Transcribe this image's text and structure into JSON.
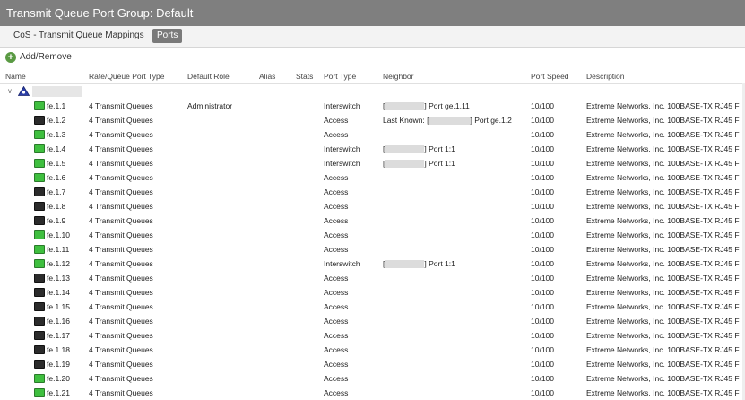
{
  "title": "Transmit Queue Port Group: Default",
  "tabs": [
    {
      "label": "CoS - Transmit Queue Mappings"
    },
    {
      "label": "Ports"
    }
  ],
  "toolbar": {
    "add_remove": "Add/Remove",
    "add_icon_glyph": "+"
  },
  "columns": [
    "Name",
    "Rate/Queue Port Type",
    "Default Role",
    "Alias",
    "Stats",
    "Port Type",
    "Neighbor",
    "Port Speed",
    "Description"
  ],
  "icons": {
    "port_up": "port-green-icon",
    "port_down": "port-black-icon",
    "device": "device-triangle-icon"
  },
  "colors": {
    "title_bar": "#7f7f7f",
    "active_tab": "#7a7a7a",
    "port_up": "#3fbf3f",
    "port_down": "#2b2b2b",
    "add": "#5a9a43"
  },
  "rows": [
    {
      "name": "fe.1.1",
      "rate": "4 Transmit Queues",
      "role": "Administrator",
      "type": "Interswitch",
      "neighbor_pre": "[",
      "neighbor_post": "] Port ge.1.11",
      "speed": "10/100",
      "desc": "Extreme Networks, Inc. 100BASE-TX RJ45 F",
      "status": "up"
    },
    {
      "name": "fe.1.2",
      "rate": "4 Transmit Queues",
      "role": "",
      "type": "Access",
      "neighbor_pre": "Last Known: [",
      "neighbor_post": "] Port ge.1.2",
      "speed": "10/100",
      "desc": "Extreme Networks, Inc. 100BASE-TX RJ45 F",
      "status": "down"
    },
    {
      "name": "fe.1.3",
      "rate": "4 Transmit Queues",
      "role": "",
      "type": "Access",
      "neighbor_pre": "",
      "neighbor_post": "",
      "speed": "10/100",
      "desc": "Extreme Networks, Inc. 100BASE-TX RJ45 F",
      "status": "up"
    },
    {
      "name": "fe.1.4",
      "rate": "4 Transmit Queues",
      "role": "",
      "type": "Interswitch",
      "neighbor_pre": "[",
      "neighbor_post": "] Port 1:1",
      "speed": "10/100",
      "desc": "Extreme Networks, Inc. 100BASE-TX RJ45 F",
      "status": "up"
    },
    {
      "name": "fe.1.5",
      "rate": "4 Transmit Queues",
      "role": "",
      "type": "Interswitch",
      "neighbor_pre": "[",
      "neighbor_post": "] Port 1:1",
      "speed": "10/100",
      "desc": "Extreme Networks, Inc. 100BASE-TX RJ45 F",
      "status": "up"
    },
    {
      "name": "fe.1.6",
      "rate": "4 Transmit Queues",
      "role": "",
      "type": "Access",
      "neighbor_pre": "",
      "neighbor_post": "",
      "speed": "10/100",
      "desc": "Extreme Networks, Inc. 100BASE-TX RJ45 F",
      "status": "up"
    },
    {
      "name": "fe.1.7",
      "rate": "4 Transmit Queues",
      "role": "",
      "type": "Access",
      "neighbor_pre": "",
      "neighbor_post": "",
      "speed": "10/100",
      "desc": "Extreme Networks, Inc. 100BASE-TX RJ45 F",
      "status": "down"
    },
    {
      "name": "fe.1.8",
      "rate": "4 Transmit Queues",
      "role": "",
      "type": "Access",
      "neighbor_pre": "",
      "neighbor_post": "",
      "speed": "10/100",
      "desc": "Extreme Networks, Inc. 100BASE-TX RJ45 F",
      "status": "down"
    },
    {
      "name": "fe.1.9",
      "rate": "4 Transmit Queues",
      "role": "",
      "type": "Access",
      "neighbor_pre": "",
      "neighbor_post": "",
      "speed": "10/100",
      "desc": "Extreme Networks, Inc. 100BASE-TX RJ45 F",
      "status": "down"
    },
    {
      "name": "fe.1.10",
      "rate": "4 Transmit Queues",
      "role": "",
      "type": "Access",
      "neighbor_pre": "",
      "neighbor_post": "",
      "speed": "10/100",
      "desc": "Extreme Networks, Inc. 100BASE-TX RJ45 F",
      "status": "up"
    },
    {
      "name": "fe.1.11",
      "rate": "4 Transmit Queues",
      "role": "",
      "type": "Access",
      "neighbor_pre": "",
      "neighbor_post": "",
      "speed": "10/100",
      "desc": "Extreme Networks, Inc. 100BASE-TX RJ45 F",
      "status": "up"
    },
    {
      "name": "fe.1.12",
      "rate": "4 Transmit Queues",
      "role": "",
      "type": "Interswitch",
      "neighbor_pre": "[",
      "neighbor_post": "] Port 1:1",
      "speed": "10/100",
      "desc": "Extreme Networks, Inc. 100BASE-TX RJ45 F",
      "status": "up"
    },
    {
      "name": "fe.1.13",
      "rate": "4 Transmit Queues",
      "role": "",
      "type": "Access",
      "neighbor_pre": "",
      "neighbor_post": "",
      "speed": "10/100",
      "desc": "Extreme Networks, Inc. 100BASE-TX RJ45 F",
      "status": "down"
    },
    {
      "name": "fe.1.14",
      "rate": "4 Transmit Queues",
      "role": "",
      "type": "Access",
      "neighbor_pre": "",
      "neighbor_post": "",
      "speed": "10/100",
      "desc": "Extreme Networks, Inc. 100BASE-TX RJ45 F",
      "status": "down"
    },
    {
      "name": "fe.1.15",
      "rate": "4 Transmit Queues",
      "role": "",
      "type": "Access",
      "neighbor_pre": "",
      "neighbor_post": "",
      "speed": "10/100",
      "desc": "Extreme Networks, Inc. 100BASE-TX RJ45 F",
      "status": "down"
    },
    {
      "name": "fe.1.16",
      "rate": "4 Transmit Queues",
      "role": "",
      "type": "Access",
      "neighbor_pre": "",
      "neighbor_post": "",
      "speed": "10/100",
      "desc": "Extreme Networks, Inc. 100BASE-TX RJ45 F",
      "status": "down"
    },
    {
      "name": "fe.1.17",
      "rate": "4 Transmit Queues",
      "role": "",
      "type": "Access",
      "neighbor_pre": "",
      "neighbor_post": "",
      "speed": "10/100",
      "desc": "Extreme Networks, Inc. 100BASE-TX RJ45 F",
      "status": "down"
    },
    {
      "name": "fe.1.18",
      "rate": "4 Transmit Queues",
      "role": "",
      "type": "Access",
      "neighbor_pre": "",
      "neighbor_post": "",
      "speed": "10/100",
      "desc": "Extreme Networks, Inc. 100BASE-TX RJ45 F",
      "status": "down"
    },
    {
      "name": "fe.1.19",
      "rate": "4 Transmit Queues",
      "role": "",
      "type": "Access",
      "neighbor_pre": "",
      "neighbor_post": "",
      "speed": "10/100",
      "desc": "Extreme Networks, Inc. 100BASE-TX RJ45 F",
      "status": "down"
    },
    {
      "name": "fe.1.20",
      "rate": "4 Transmit Queues",
      "role": "",
      "type": "Access",
      "neighbor_pre": "",
      "neighbor_post": "",
      "speed": "10/100",
      "desc": "Extreme Networks, Inc. 100BASE-TX RJ45 F",
      "status": "up"
    },
    {
      "name": "fe.1.21",
      "rate": "4 Transmit Queues",
      "role": "",
      "type": "Access",
      "neighbor_pre": "",
      "neighbor_post": "",
      "speed": "10/100",
      "desc": "Extreme Networks, Inc. 100BASE-TX RJ45 F",
      "status": "up"
    }
  ]
}
